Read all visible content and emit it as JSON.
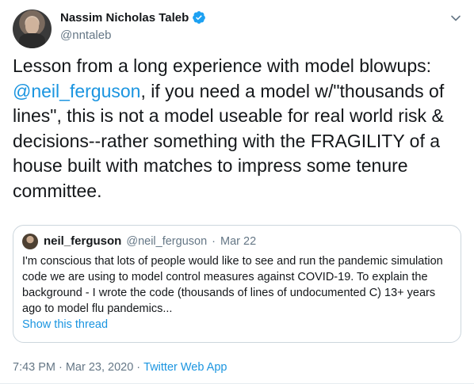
{
  "author": {
    "display_name": "Nassim Nicholas Taleb",
    "handle": "@nntaleb",
    "verified": true
  },
  "tweet": {
    "text_before": "Lesson from a long experience with model blowups: ",
    "mention": "@neil_ferguson",
    "text_after": ", if you need a model w/\"thousands of lines\", this is not a model useable for real world risk & decisions--rather something with the FRAGILITY of a house built with matches to impress some tenure committee."
  },
  "quoted_tweet": {
    "display_name": "neil_ferguson",
    "handle": "@neil_ferguson",
    "separator": "·",
    "date": "Mar 22",
    "text": "I'm conscious that lots of people would like to see and run the pandemic simulation code we are using to model control measures against COVID-19.  To explain the background - I wrote the code (thousands of lines of undocumented C) 13+ years ago to model flu pandemics...",
    "show_thread_label": "Show this thread"
  },
  "footer": {
    "time": "7:43 PM",
    "separator1": "·",
    "date": "Mar 23, 2020",
    "separator2": "·",
    "source": "Twitter Web App"
  },
  "colors": {
    "link": "#1b95e0",
    "secondary_text": "#657786",
    "verified_badge": "#1da1f2"
  },
  "icons": {
    "verified": "verified-badge-icon",
    "caret": "chevron-down-icon"
  }
}
